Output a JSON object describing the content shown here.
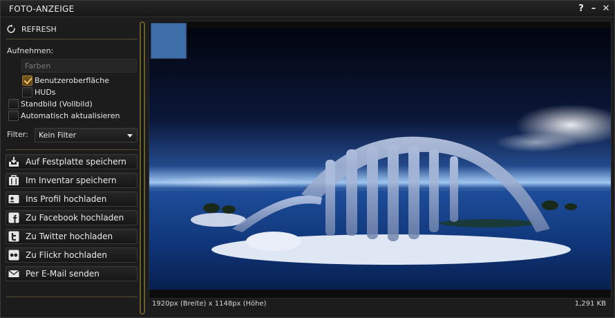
{
  "window": {
    "title": "FOTO-ANZEIGE",
    "help_label": "?",
    "minimize_label": "–",
    "close_label": "✕"
  },
  "left": {
    "refresh_label": "REFRESH",
    "capture_label": "Aufnehmen:",
    "colors_placeholder": "Farben",
    "checkboxes": {
      "ui": {
        "label": "Benutzeroberfläche",
        "checked": true
      },
      "huds": {
        "label": "HUDs",
        "checked": false
      },
      "fullres": {
        "label": "Standbild (Vollbild)",
        "checked": false
      },
      "autoupdate": {
        "label": "Automatisch aktualisieren",
        "checked": false
      }
    },
    "filter_label": "Filter:",
    "filter_value": "Kein Filter",
    "actions": [
      {
        "label": "Auf Festplatte speichern",
        "icon": "save-disk-icon"
      },
      {
        "label": "Im Inventar speichern",
        "icon": "inventory-icon"
      },
      {
        "label": "Ins Profil hochladen",
        "icon": "profile-icon"
      },
      {
        "label": "Zu Facebook hochladen",
        "icon": "facebook-icon"
      },
      {
        "label": "Zu Twitter hochladen",
        "icon": "twitter-icon"
      },
      {
        "label": "Zu Flickr hochladen",
        "icon": "flickr-icon"
      },
      {
        "label": "Per E-Mail senden",
        "icon": "email-icon"
      }
    ]
  },
  "preview": {
    "dimensions_text": "1920px (Breite) x 1148px (Höhe)",
    "file_size_text": "1,291 KB"
  },
  "colors": {
    "accent": "#6a5e2e",
    "background": "#1c1c1c",
    "checkbox_checked": "#f2c15a"
  }
}
